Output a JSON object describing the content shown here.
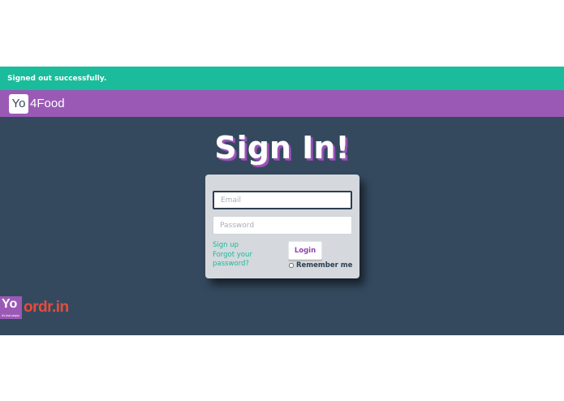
{
  "flash": {
    "message": "Signed out successfully."
  },
  "navbar": {
    "brand_box": "Yo",
    "brand_rest": "4Food"
  },
  "page": {
    "title": "Sign In!"
  },
  "form": {
    "email_placeholder": "Email",
    "password_placeholder": "Password",
    "sign_up_label": "Sign up",
    "forgot_password_label": "Forgot your password?",
    "login_label": "Login",
    "remember_label": "Remember me"
  },
  "footer": {
    "yo_logo_text": "Yo",
    "yo_logo_tagline": "it's that simple",
    "partner_logo_text": "ordr.in"
  },
  "colors": {
    "flash": "#1abc9c",
    "navbar": "#9b59b6",
    "background": "#34495e",
    "card": "#d5d8dd",
    "link": "#1abc9c",
    "accent": "#8e44ad",
    "partner": "#e74c3c"
  }
}
